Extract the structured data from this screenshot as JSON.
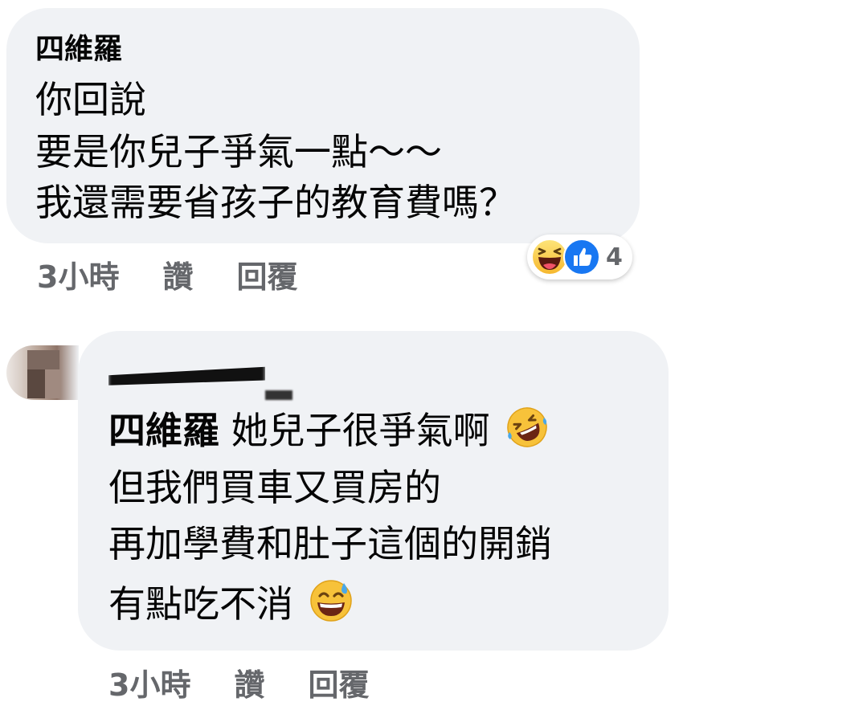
{
  "comments": [
    {
      "author": "四維羅",
      "lines": [
        "你回說",
        "要是你兒子爭氣一點～～",
        "我還需要省孩子的教育費嗎？"
      ],
      "time": "3小時",
      "like_label": "讚",
      "reply_label": "回覆",
      "reactions": {
        "icons": [
          "haha-emoji-icon",
          "like-thumb-icon"
        ],
        "count": "4"
      }
    },
    {
      "author": "",
      "mention": "四維羅",
      "lines": [
        "她兒子很爭氣啊",
        "但我們買車又買房的",
        "再加學費和肚子這個的開銷",
        "有點吃不消"
      ],
      "line_emojis": [
        "rolling-laughing-emoji-icon",
        "",
        "",
        "sweat-smile-emoji-icon"
      ],
      "time": "3小時",
      "like_label": "讚",
      "reply_label": "回覆"
    }
  ],
  "colors": {
    "bubble": "#f0f2f5",
    "meta_text": "#65676b",
    "like_blue": "#1877f2",
    "emoji_yellow": "#f7c23a"
  }
}
